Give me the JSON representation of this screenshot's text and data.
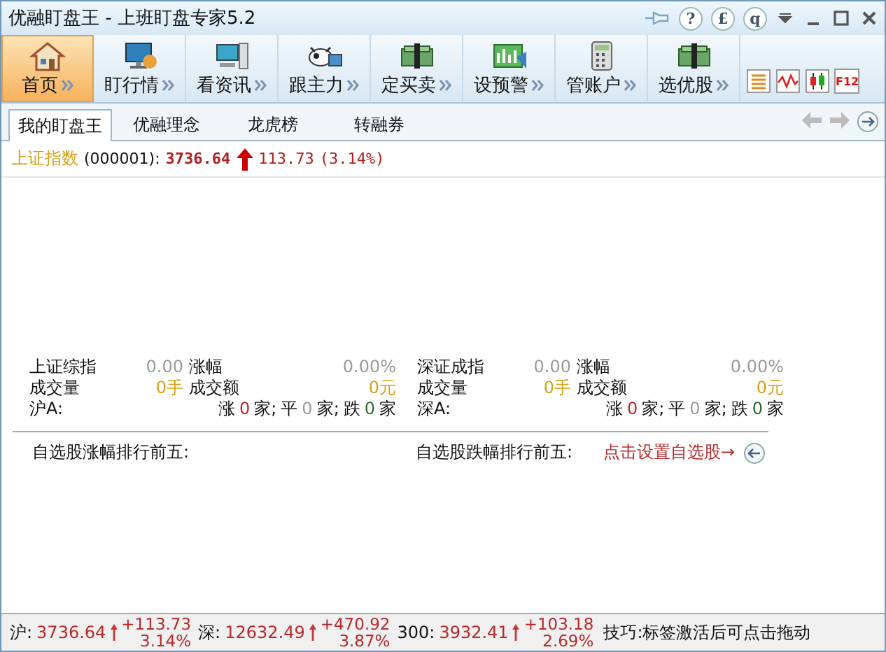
{
  "window": {
    "title": "优融盯盘王 - 上班盯盘专家5.2",
    "help_buttons": [
      "?",
      "£",
      "q"
    ]
  },
  "toolbar": [
    {
      "label": "首页",
      "selected": true
    },
    {
      "label": "盯行情",
      "selected": false
    },
    {
      "label": "看资讯",
      "selected": false
    },
    {
      "label": "跟主力",
      "selected": false
    },
    {
      "label": "定买卖",
      "selected": false
    },
    {
      "label": "设预警",
      "selected": false
    },
    {
      "label": "管账户",
      "selected": false
    },
    {
      "label": "选优股",
      "selected": false
    }
  ],
  "toolbar_small": [
    {
      "kind": "list"
    },
    {
      "kind": "wave"
    },
    {
      "kind": "candles"
    },
    {
      "kind": "text",
      "text": "F12"
    }
  ],
  "tabs": [
    {
      "label": "我的盯盘王",
      "selected": true
    },
    {
      "label": "优融理念",
      "selected": false
    },
    {
      "label": "龙虎榜",
      "selected": false
    },
    {
      "label": "转融券",
      "selected": false
    }
  ],
  "index_line": {
    "name": "上证指数",
    "code": "(000001):",
    "value": "3736.64",
    "change": "113.73",
    "percent": "(3.14%)"
  },
  "markets": [
    {
      "name": "上证综指",
      "index": "0.00",
      "change_label": "涨幅",
      "change": "0.00%",
      "volume_label": "成交量",
      "volume": "0手",
      "amount_label": "成交额",
      "amount": "0元",
      "breadth_label": "沪A:",
      "up_label": "涨",
      "up": "0",
      "up_unit": "家;",
      "flat_label": "平",
      "flat": "0",
      "flat_unit": "家;",
      "down_label": "跌",
      "down": "0",
      "down_unit": "家"
    },
    {
      "name": "深证成指",
      "index": "0.00",
      "change_label": "涨幅",
      "change": "0.00%",
      "volume_label": "成交量",
      "volume": "0手",
      "amount_label": "成交额",
      "amount": "0元",
      "breadth_label": "深A:",
      "up_label": "涨",
      "up": "0",
      "up_unit": "家;",
      "flat_label": "平",
      "flat": "0",
      "flat_unit": "家;",
      "down_label": "跌",
      "down": "0",
      "down_unit": "家"
    }
  ],
  "rankings": {
    "gainers_title": "自选股涨幅排行前五:",
    "losers_title": "自选股跌幅排行前五:",
    "setup_link": "点击设置自选股→"
  },
  "status_bar": {
    "quotes": [
      {
        "label": "沪:",
        "value": "3736.64",
        "change": "+113.73",
        "percent": "3.14%"
      },
      {
        "label": "深:",
        "value": "12632.49",
        "change": "+470.92",
        "percent": "3.87%"
      },
      {
        "label": "300:",
        "value": "3932.41",
        "change": "+103.18",
        "percent": "2.69%"
      }
    ],
    "tip": "技巧:标签激活后可点击拖动"
  }
}
